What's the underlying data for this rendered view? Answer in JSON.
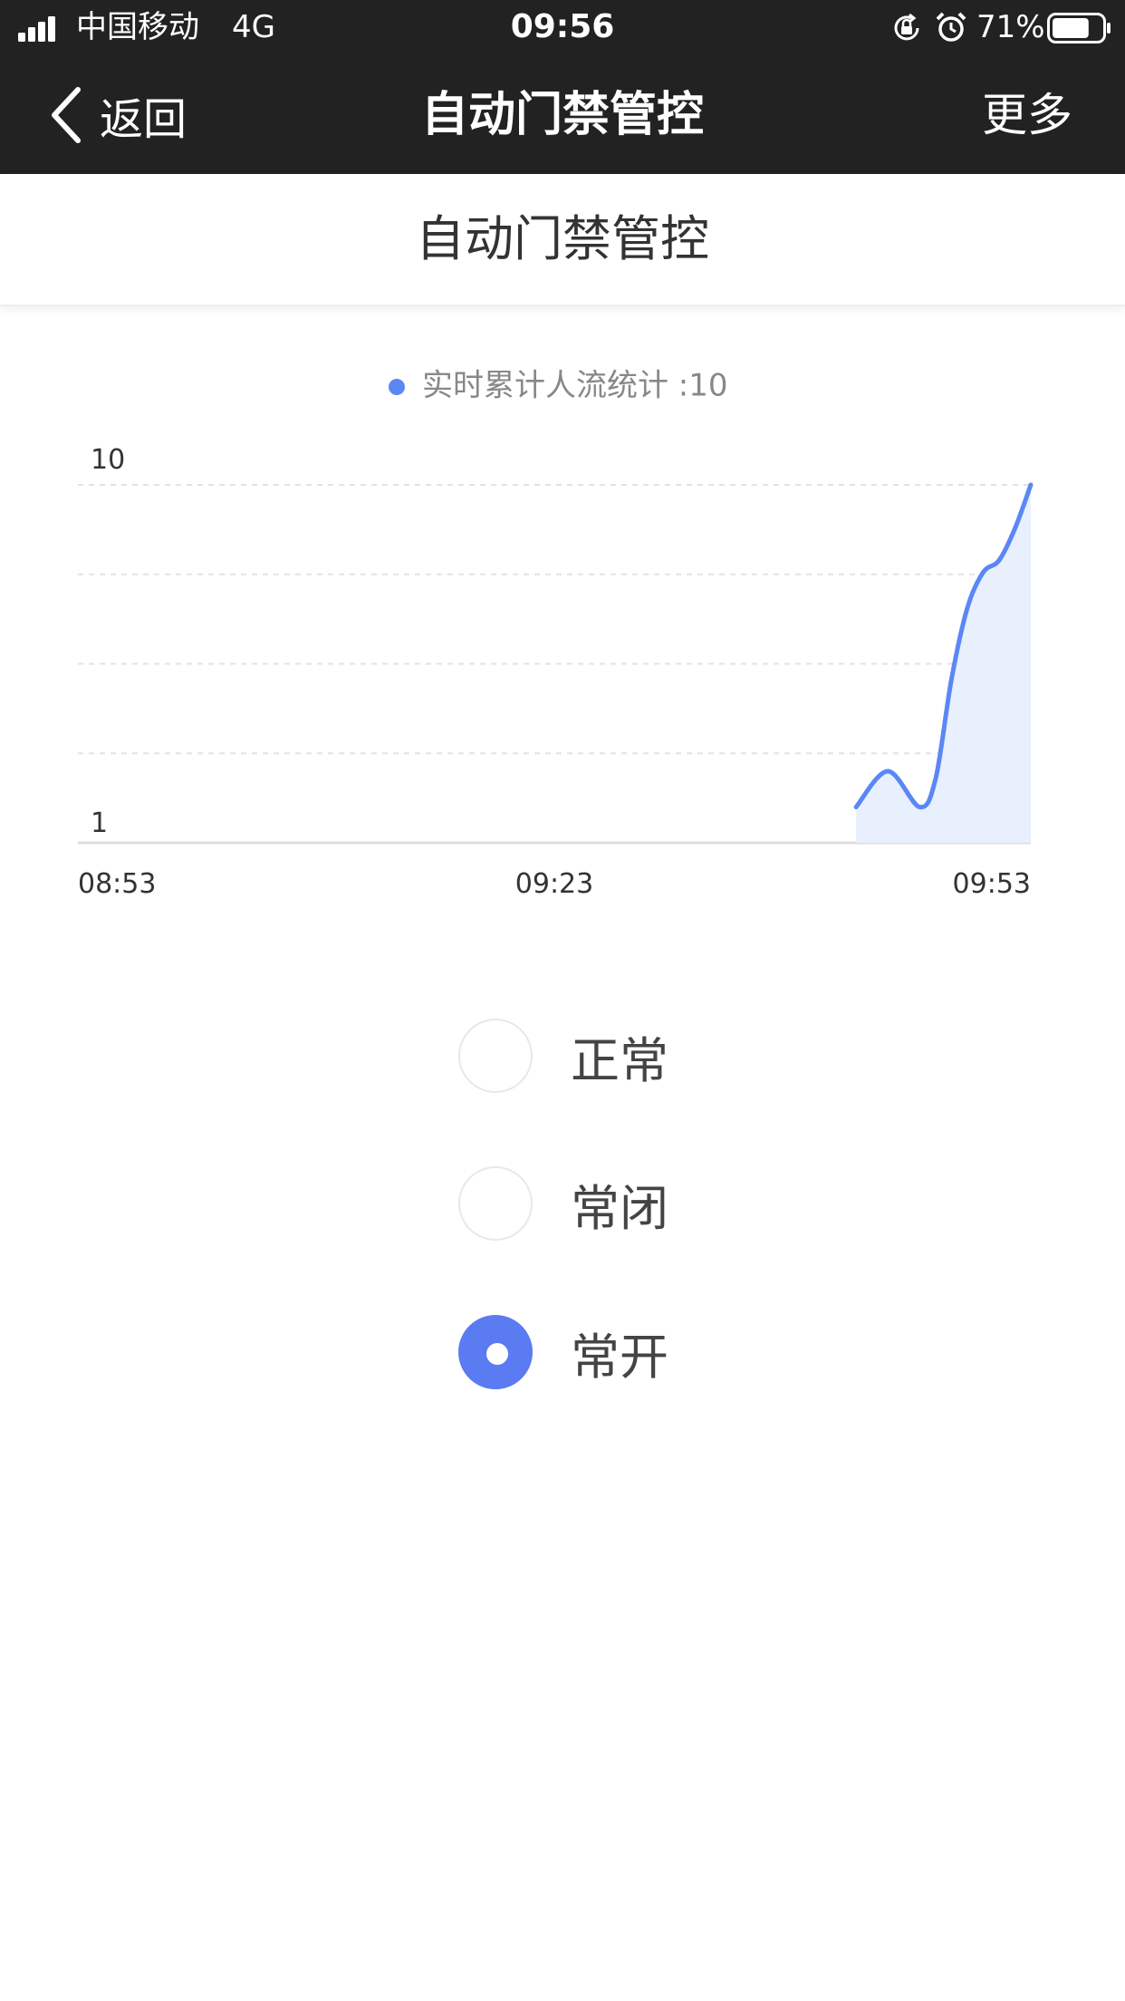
{
  "status_bar": {
    "carrier": "中国移动",
    "network": "4G",
    "time": "09:56",
    "battery": "71%",
    "battery_level": 0.71,
    "icons": [
      "signal-icon",
      "rotation-lock-icon",
      "alarm-icon",
      "battery-icon"
    ]
  },
  "nav": {
    "back_label": "返回",
    "title": "自动门禁管控",
    "more_label": "更多"
  },
  "header": {
    "title": "自动门禁管控"
  },
  "chart_data": {
    "type": "area",
    "legend": [
      {
        "name": "实时累计人流统计 :10",
        "color": "#5b87f5"
      }
    ],
    "legend_position": "top-center",
    "y_ticks": [
      "10",
      "1"
    ],
    "ylim": [
      1,
      10
    ],
    "x_ticks": [
      "08:53",
      "09:23",
      "09:53"
    ],
    "grid": "dashed-horizontal",
    "series": [
      {
        "color": "#5b87f5",
        "fill": "#e8effd",
        "x": [
          "09:42",
          "09:44",
          "09:46",
          "09:47",
          "09:48",
          "09:49",
          "09:50",
          "09:51",
          "09:52",
          "09:53"
        ],
        "values": [
          1.9,
          2.8,
          1.9,
          2.6,
          5.1,
          6.9,
          7.8,
          8.1,
          8.9,
          10
        ]
      }
    ]
  },
  "modes": {
    "options": [
      {
        "label": "正常",
        "checked": false
      },
      {
        "label": "常闭",
        "checked": false
      },
      {
        "label": "常开",
        "checked": true
      }
    ],
    "accent_color": "#5b7bf2"
  }
}
